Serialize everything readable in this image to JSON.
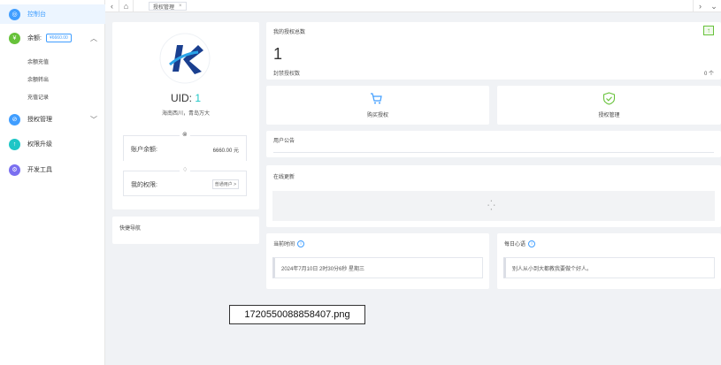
{
  "sidebar": {
    "dashboard_label": "控制台",
    "balance_label": "余额:",
    "balance_value": "¥6660.00",
    "sub_items": [
      "余额充值",
      "余额转出",
      "充值记录"
    ],
    "auth_manage_label": "授权管理",
    "auth_upgrade_label": "权限升级",
    "dev_tools_label": "开发工具"
  },
  "topbar": {
    "tab_label": "授权管理",
    "tab_close": "×"
  },
  "profile": {
    "uid_label": "UID:",
    "uid_value": "1",
    "location": "海南西川，青岛万大",
    "account_balance_label": "账户余额:",
    "account_balance_value": "6660.00 元",
    "permission_label": "我的权限:",
    "permission_value": "普通用户 >"
  },
  "quick_nav": {
    "label": "快捷导航"
  },
  "auth_count": {
    "title": "我的授权总数",
    "value": "1",
    "sub_label": "封禁授权数",
    "sub_value": "0 个"
  },
  "actions": {
    "buy_label": "购买授权",
    "manage_label": "授权管理"
  },
  "notice": {
    "title": "用户公告"
  },
  "update_log": {
    "title": "在线更新"
  },
  "current_time": {
    "title": "当前时间",
    "value": "2024年7月10日 2时30分6秒 星期三"
  },
  "daily_quote": {
    "title": "每日心语",
    "value": "别人从小到大都教我要做个好人。"
  },
  "filename": "1720550088858407.png",
  "colors": {
    "accent": "#409eff",
    "green": "#67c23a",
    "teal": "#1ec6c6",
    "purple": "#7a6ff0"
  }
}
